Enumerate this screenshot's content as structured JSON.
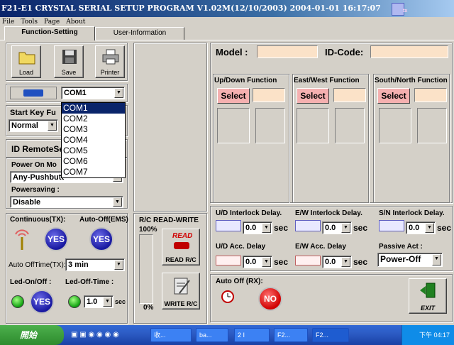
{
  "window": {
    "title": "F21-E1 CRYSTAL SERIAL SETUP PROGRAM V1.02M(12/10/2003)  2004-01-01  16:17:07",
    "badge": "tx"
  },
  "menu": [
    "File",
    "Tools",
    "Page",
    "About"
  ],
  "tabs": {
    "function": "Function-Setting",
    "user": "User-Information"
  },
  "toolbar": {
    "load": "Load",
    "save": "Save",
    "printer": "Printer"
  },
  "com": {
    "selected": "COM1",
    "options": [
      "COM1",
      "COM2",
      "COM3",
      "COM4",
      "COM5",
      "COM6",
      "COM7"
    ]
  },
  "left": {
    "start_key_label": "Start Key Fu",
    "start_key_value": "Normal",
    "id_remote_label": "ID RemoteSe",
    "power_on_label": "Power On Mo",
    "power_on_value": "Any-Pushbutt",
    "powersaving_label": "Powersaving  :",
    "powersaving_value": "Disable"
  },
  "left_lower": {
    "continuous_label": "Continuous(TX):",
    "auto_off_ems_label": "Auto-Off(EMS)",
    "yes": "YES",
    "auto_off_time_label": "Auto OffTime(TX):",
    "auto_off_time_value": "3   min",
    "led_onoff_label": "Led-On/Off  :",
    "led_off_time_label": "Led-Off-Time :",
    "led_off_time_value": "1.0",
    "sec": "sec"
  },
  "rc": {
    "title": "R/C READ-WRITE",
    "percent_top": "100%",
    "percent_bottom": "0%",
    "read_label": "READ  R/C",
    "write_label": "WRITE R/C",
    "read_icon_text": "READ"
  },
  "model": {
    "model_label": "Model  :",
    "idcode_label": "ID-Code:"
  },
  "functions": [
    {
      "title": "Up/Down Function",
      "select": "Select"
    },
    {
      "title": "East/West Function",
      "select": "Select"
    },
    {
      "title": "South/North Function",
      "select": "Select"
    }
  ],
  "interlock": [
    {
      "label": "U/D Interlock Delay.",
      "value": "0.0",
      "unit": "sec"
    },
    {
      "label": "E/W Interlock Delay.",
      "value": "0.0",
      "unit": "sec"
    },
    {
      "label": "S/N Interlock Delay.",
      "value": "0.0",
      "unit": "sec"
    }
  ],
  "acc": [
    {
      "label": "U/D Acc. Delay",
      "value": "0.0",
      "unit": "sec"
    },
    {
      "label": "E/W Acc. Delay",
      "value": "0.0",
      "unit": "sec"
    }
  ],
  "passive": {
    "label": "Passive Act :",
    "value": "Power-Off"
  },
  "auto_off_rx": {
    "label": "Auto Off (RX):",
    "no": "NO"
  },
  "exit_label": "EXIT",
  "taskbar": {
    "start": "開始",
    "items": [
      "收...",
      "ba...",
      "2 I",
      "F2...",
      "F2..."
    ],
    "clock": "下午 04:17"
  }
}
